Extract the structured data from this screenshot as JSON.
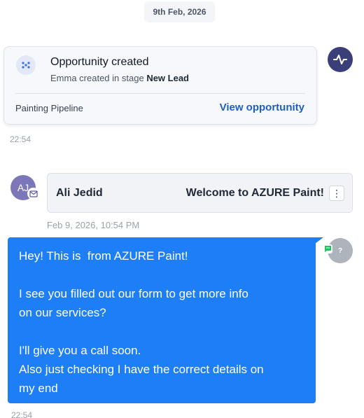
{
  "date_separator": "9th Feb, 2026",
  "opportunity": {
    "title": "Opportunity created",
    "subtitle_prefix": "Emma created in stage",
    "stage": "New Lead",
    "pipeline": "Painting Pipeline",
    "link_label": "View opportunity",
    "time": "22:54",
    "icon": "pipeline-icon",
    "avatar_icon": "activity-pulse-icon"
  },
  "email": {
    "avatar_initials": "AJ",
    "from": "Ali Jedid",
    "subject": "Welcome to AZURE Paint!",
    "menu_icon": "⋮",
    "timestamp": "Feb 9, 2026, 10:54 PM",
    "channel_icon": "mail-icon"
  },
  "sms": {
    "lines": [
      "Hey! This is  from AZURE Paint!",
      "",
      "I see you filled out our form to get more info",
      "on our services?",
      "",
      "I'll give you a call soon.",
      "Also just checking I have the correct details on",
      "my end"
    ],
    "time": "22:54",
    "avatar_initials": "?",
    "channel_icon": "sms-icon"
  },
  "colors": {
    "bubble": "#1e7ef5",
    "link": "#1d5fbf",
    "activity_avatar": "#3a3f7a",
    "email_avatar": "#7c77b9",
    "sms_badge": "#22c55e"
  }
}
